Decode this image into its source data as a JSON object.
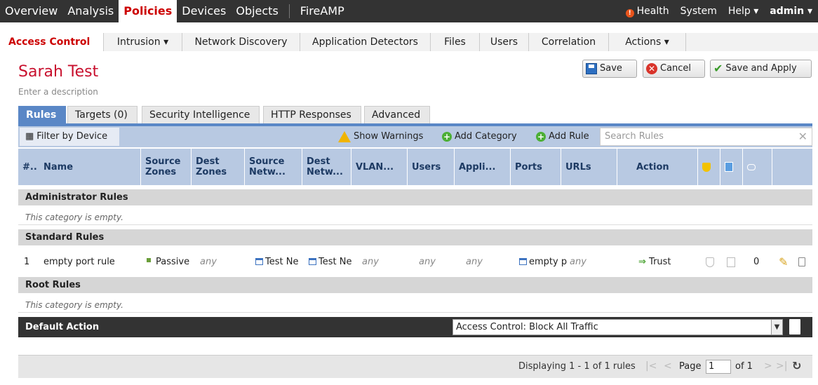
{
  "topnav": {
    "items": [
      "Overview",
      "Analysis",
      "Policies",
      "Devices",
      "Objects",
      "FireAMP"
    ],
    "right": {
      "health": "Health",
      "system": "System",
      "help": "Help ▾",
      "user": "admin ▾"
    }
  },
  "subnav": {
    "items": [
      "Access Control",
      "Intrusion ▾",
      "Network Discovery",
      "Application Detectors",
      "Files",
      "Users",
      "Correlation",
      "Actions ▾"
    ]
  },
  "policy": {
    "name": "Sarah Test",
    "description_placeholder": "Enter a description"
  },
  "buttons": {
    "save": "Save",
    "cancel": "Cancel",
    "save_apply": "Save and Apply"
  },
  "tabs": [
    "Rules",
    "Targets (0)",
    "Security Intelligence",
    "HTTP Responses",
    "Advanced"
  ],
  "toolbar": {
    "filter": "Filter by Device",
    "show_warnings": "Show Warnings",
    "add_category": "Add Category",
    "add_rule": "Add Rule",
    "search_placeholder": "Search Rules"
  },
  "columns": [
    "#..",
    "Name",
    "Source Zones",
    "Dest Zones",
    "Source Netw...",
    "Dest Netw...",
    "VLAN...",
    "Users",
    "Appli...",
    "Ports",
    "URLs",
    "Action"
  ],
  "categories": {
    "admin": "Administrator Rules",
    "standard": "Standard Rules",
    "root": "Root Rules",
    "empty_text": "This category is empty."
  },
  "rule": {
    "num": "1",
    "name": "empty port rule",
    "source_zones": "Passive",
    "dest_zones": "any",
    "source_networks": "Test Ne",
    "dest_networks": "Test Ne",
    "vlan": "any",
    "users": "any",
    "applications": "any",
    "ports": "empty p",
    "urls": "any",
    "action": "Trust",
    "comments": "0"
  },
  "default_action": {
    "label": "Default Action",
    "value": "Access Control: Block All Traffic"
  },
  "footer": {
    "displaying": "Displaying 1 - 1 of 1 rules",
    "page_label": "Page",
    "page": "1",
    "of": "of 1"
  }
}
